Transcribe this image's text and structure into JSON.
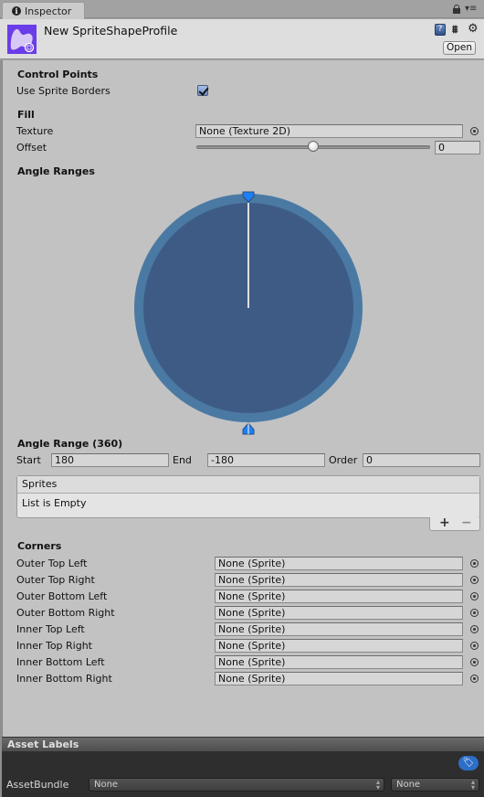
{
  "window": {
    "tab_label": "Inspector",
    "tab_icon": "info-icon",
    "lock_icon": "lock-icon",
    "menu_icon": "menu-icon"
  },
  "header": {
    "asset_name": "New SpriteShapeProfile",
    "asset_icon": "sprite-shape-profile-icon",
    "help_label": "?",
    "open_label": "Open"
  },
  "control_points": {
    "title": "Control Points",
    "use_sprite_borders_label": "Use Sprite Borders",
    "use_sprite_borders": true
  },
  "fill": {
    "title": "Fill",
    "texture_label": "Texture",
    "texture_value": "None (Texture 2D)",
    "offset_label": "Offset",
    "offset_value": "0",
    "offset_slider_fraction": 0.5
  },
  "angle_ranges": {
    "title": "Angle Ranges",
    "range_title": "Angle Range (360)",
    "start_label": "Start",
    "start_value": "180",
    "end_label": "End",
    "end_value": "-180",
    "order_label": "Order",
    "order_value": "0",
    "wheel_colors": {
      "outer": "#4a7aa3",
      "inner": "#3e5b86",
      "handle": "#1f7ef5"
    }
  },
  "sprites": {
    "header": "Sprites",
    "empty_text": "List is Empty",
    "add_label": "+",
    "remove_label": "−"
  },
  "corners": {
    "title": "Corners",
    "items": [
      {
        "label": "Outer Top Left",
        "value": "None (Sprite)"
      },
      {
        "label": "Outer Top Right",
        "value": "None (Sprite)"
      },
      {
        "label": "Outer Bottom Left",
        "value": "None (Sprite)"
      },
      {
        "label": "Outer Bottom Right",
        "value": "None (Sprite)"
      },
      {
        "label": "Inner Top Left",
        "value": "None (Sprite)"
      },
      {
        "label": "Inner Top Right",
        "value": "None (Sprite)"
      },
      {
        "label": "Inner Bottom Left",
        "value": "None (Sprite)"
      },
      {
        "label": "Inner Bottom Right",
        "value": "None (Sprite)"
      }
    ]
  },
  "asset_labels": {
    "title": "Asset Labels",
    "asset_bundle_label": "AssetBundle",
    "bundle_name": "None",
    "bundle_variant": "None"
  }
}
